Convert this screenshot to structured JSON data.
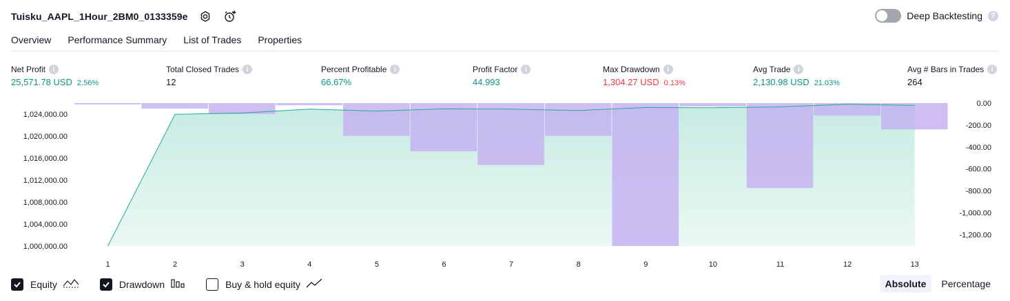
{
  "header": {
    "strategy_name": "Tuisku_AAPL_1Hour_2BM0_0133359e",
    "deep_backtesting_label": "Deep Backtesting",
    "help_glyph": "?"
  },
  "tabs": [
    {
      "label": "Overview"
    },
    {
      "label": "Performance Summary"
    },
    {
      "label": "List of Trades"
    },
    {
      "label": "Properties"
    }
  ],
  "metrics": [
    {
      "label": "Net Profit",
      "value": "25,571.78 USD",
      "pct": "2.56%",
      "color": "#089981"
    },
    {
      "label": "Total Closed Trades",
      "value": "12",
      "pct": "",
      "color": "#131722"
    },
    {
      "label": "Percent Profitable",
      "value": "66.67%",
      "pct": "",
      "color": "#089981"
    },
    {
      "label": "Profit Factor",
      "value": "44.993",
      "pct": "",
      "color": "#089981"
    },
    {
      "label": "Max Drawdown",
      "value": "1,304.27 USD",
      "pct": "0.13%",
      "color": "#f23645"
    },
    {
      "label": "Avg Trade",
      "value": "2,130.98 USD",
      "pct": "21.03%",
      "color": "#089981"
    },
    {
      "label": "Avg # Bars in Trades",
      "value": "264",
      "pct": "",
      "color": "#131722"
    }
  ],
  "info_glyph": "i",
  "chart_data": {
    "type": "area",
    "x": [
      1,
      2,
      3,
      4,
      5,
      6,
      7,
      8,
      9,
      10,
      11,
      12,
      13
    ],
    "series": [
      {
        "name": "Equity",
        "axis": "left",
        "type": "area",
        "values": [
          1000000,
          1023950,
          1024200,
          1024900,
          1024550,
          1024950,
          1024900,
          1024650,
          1025200,
          1025150,
          1025300,
          1025800,
          1025571.78
        ]
      },
      {
        "name": "Drawdown",
        "axis": "right",
        "type": "bar",
        "values": [
          0,
          -50,
          -100,
          -20,
          -300,
          -440,
          -565,
          -300,
          -1304.27,
          -30,
          -775,
          -115,
          -240
        ]
      }
    ],
    "left_axis": {
      "ticks": [
        "1,024,000.00",
        "1,020,000.00",
        "1,016,000.00",
        "1,012,000.00",
        "1,008,000.00",
        "1,004,000.00",
        "1,000,000.00"
      ],
      "range": [
        1000000,
        1026000
      ]
    },
    "right_axis": {
      "ticks": [
        "0.00",
        "-200.00",
        "-400.00",
        "-600.00",
        "-800.00",
        "-1,000.00",
        "-1,200.00"
      ],
      "range": [
        -1304.27,
        0
      ]
    },
    "x_labels": [
      "1",
      "2",
      "3",
      "4",
      "5",
      "6",
      "7",
      "8",
      "9",
      "10",
      "11",
      "12",
      "13"
    ],
    "colors": {
      "equity_line": "#22ab94",
      "equity_fill": "#c6ebe2",
      "drawdown_bar": "#c5b3f0"
    },
    "grid": false
  },
  "legend": {
    "equity": {
      "label": "Equity",
      "checked": true
    },
    "drawdown": {
      "label": "Drawdown",
      "checked": true
    },
    "buy_hold": {
      "label": "Buy & hold equity",
      "checked": false
    }
  },
  "modes": {
    "absolute": "Absolute",
    "percentage": "Percentage",
    "selected": "Absolute"
  }
}
